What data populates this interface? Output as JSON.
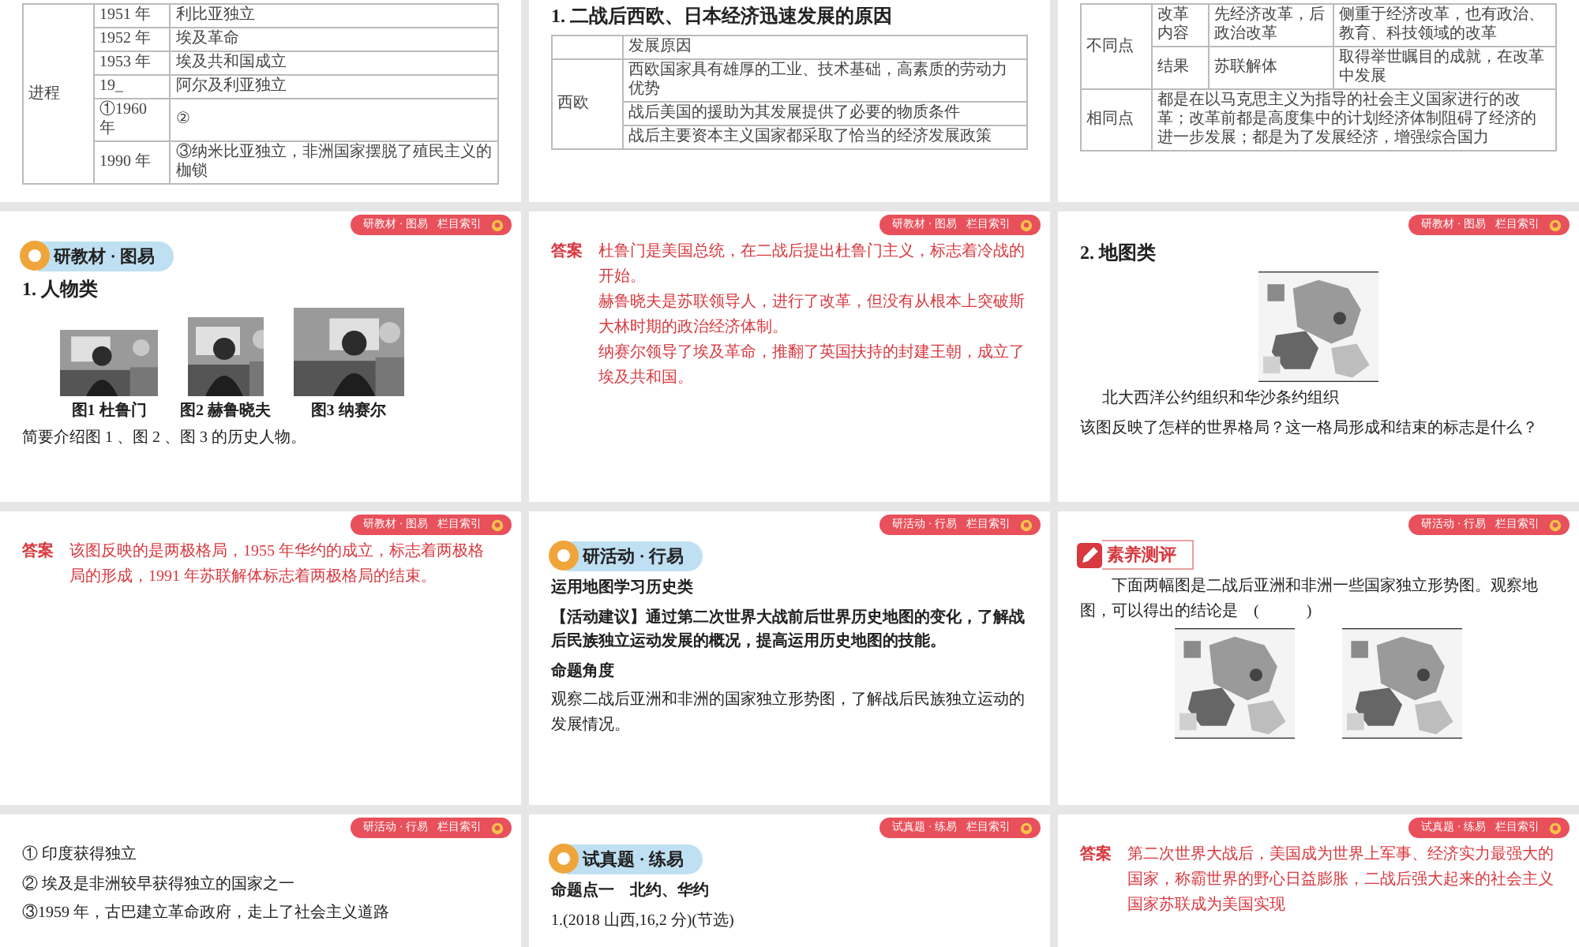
{
  "slides": [
    {
      "blocks": [
        {
          "kind": "table",
          "groups": [
            {
              "label": "进程",
              "rows": [
                [
                  "1951 年",
                  "利比亚独立"
                ],
                [
                  "1952 年",
                  "埃及革命"
                ],
                [
                  "1953 年",
                  "埃及共和国成立"
                ],
                [
                  "19_",
                  "阿尔及利亚独立"
                ],
                [
                  "①1960 年",
                  "②"
                ],
                [
                  "1990 年",
                  "③纳米比亚独立，非洲国家摆脱了殖民主义的枷锁"
                ]
              ]
            }
          ]
        }
      ]
    },
    {
      "blocks": [
        {
          "kind": "heading",
          "text": "1. 二战后西欧、日本经济迅速发展的原因"
        },
        {
          "kind": "table",
          "header": "发展原因",
          "groups": [
            {
              "label": "西欧",
              "rows": [
                [
                  "西欧国家具有雄厚的工业、技术基础，高素质的劳动力优势"
                ],
                [
                  "战后美国的援助为其发展提供了必要的物质条件"
                ],
                [
                  "战后主要资本主义国家都采取了恰当的经济发展政策"
                ]
              ]
            }
          ]
        }
      ]
    },
    {
      "blocks": [
        {
          "kind": "table",
          "groups": [
            {
              "label": "不同点",
              "rows": [
                [
                  "改革内容",
                  "先经济改革，后政治改革",
                  "侧重于经济改革，也有政治、教育、科技领域的改革"
                ],
                [
                  "结果",
                  "苏联解体",
                  "取得举世瞩目的成就，在改革中发展"
                ]
              ]
            },
            {
              "label": "相同点",
              "rows": [
                [
                  "都是在以马克思主义为指导的社会主义国家进行的改革；改革前都是高度集中的计划经济体制阻碍了经济的进一步发展；都是为了发展经济，增强综合国力"
                ]
              ]
            }
          ]
        }
      ]
    },
    {
      "badge": {
        "section": "研教材 · 图易",
        "index": "栏目索引"
      },
      "blocks": [
        {
          "kind": "section",
          "text": "研教材 · 图易"
        },
        {
          "kind": "heading",
          "text": "1. 人物类"
        },
        {
          "kind": "figures",
          "items": [
            {
              "caption": "图1  杜鲁门"
            },
            {
              "caption": "图2  赫鲁晓夫"
            },
            {
              "caption": "图3  纳赛尔"
            }
          ]
        },
        {
          "kind": "text",
          "text": "简要介绍图 1 、图 2 、图 3 的历史人物。"
        }
      ]
    },
    {
      "badge": {
        "section": "研教材 · 图易",
        "index": "栏目索引"
      },
      "blocks": [
        {
          "kind": "answer",
          "label": "答案",
          "lines": [
            "杜鲁门是美国总统，在二战后提出杜鲁门主义，标志着冷战的开始。",
            "赫鲁晓夫是苏联领导人，进行了改革，但没有从根本上突破斯大林时期的政治经济体制。",
            "纳赛尔领导了埃及革命，推翻了英国扶持的封建王朝，成立了埃及共和国。"
          ]
        }
      ]
    },
    {
      "badge": {
        "section": "研教材 · 图易",
        "index": "栏目索引"
      },
      "blocks": [
        {
          "kind": "heading",
          "text": "2. 地图类"
        },
        {
          "kind": "maps"
        },
        {
          "kind": "caption",
          "text": "北大西洋公约组织和华沙条约组织"
        },
        {
          "kind": "text",
          "text": "该图反映了怎样的世界格局？这一格局形成和结束的标志是什么？"
        }
      ]
    },
    {
      "badge": {
        "section": "研教材 · 图易",
        "index": "栏目索引"
      },
      "blocks": [
        {
          "kind": "answer",
          "label": "答案",
          "lines": [
            "该图反映的是两极格局，1955 年华约的成立，标志着两极格局的形成，1991 年苏联解体标志着两极格局的结束。"
          ]
        }
      ]
    },
    {
      "badge": {
        "section": "研活动 · 行易",
        "index": "栏目索引"
      },
      "blocks": [
        {
          "kind": "section",
          "text": "研活动 · 行易"
        },
        {
          "kind": "strong",
          "text": "运用地图学习历史类"
        },
        {
          "kind": "strong",
          "text": "【活动建议】通过第二次世界大战前后世界历史地图的变化，了解战后民族独立运动发展的概况，提高运用历史地图的技能。"
        },
        {
          "kind": "strong",
          "text": "命题角度"
        },
        {
          "kind": "text",
          "text": "观察二战后亚洲和非洲的国家独立形势图，了解战后民族独立运动的发展情况。"
        }
      ]
    },
    {
      "badge": {
        "section": "研活动 · 行易",
        "index": "栏目索引"
      },
      "blocks": [
        {
          "kind": "quiz",
          "text": "素养测评"
        },
        {
          "kind": "indent",
          "text": "下面两幅图是二战后亚洲和非洲一些国家独立形势图。观察地图，可以得出的结论是　(　　　)"
        },
        {
          "kind": "maps"
        }
      ]
    },
    {
      "badge": {
        "section": "研活动 · 行易",
        "index": "栏目索引"
      },
      "blocks": [
        {
          "kind": "text",
          "text": "① 印度获得独立"
        },
        {
          "kind": "text",
          "text": "② 埃及是非洲较早获得独立的国家之一"
        },
        {
          "kind": "text",
          "text": "③1959 年，古巴建立革命政府，走上了社会主义道路"
        }
      ]
    },
    {
      "badge": {
        "section": "试真题 · 练易",
        "index": "栏目索引"
      },
      "blocks": [
        {
          "kind": "section",
          "text": "试真题 · 练易"
        },
        {
          "kind": "strong",
          "text": "命题点一　北约、华约"
        },
        {
          "kind": "text",
          "text": "1.(2018 山西,16,2 分)(节选)"
        }
      ]
    },
    {
      "badge": {
        "section": "试真题 · 练易",
        "index": "栏目索引"
      },
      "blocks": [
        {
          "kind": "answer",
          "label": "答案",
          "lines": [
            "第二次世界大战后，美国成为世界上军事、经济实力最强大的国家，称霸世界的野心日益膨胀，二战后强大起来的社会主义国家苏联成为美国实现"
          ]
        }
      ]
    }
  ]
}
